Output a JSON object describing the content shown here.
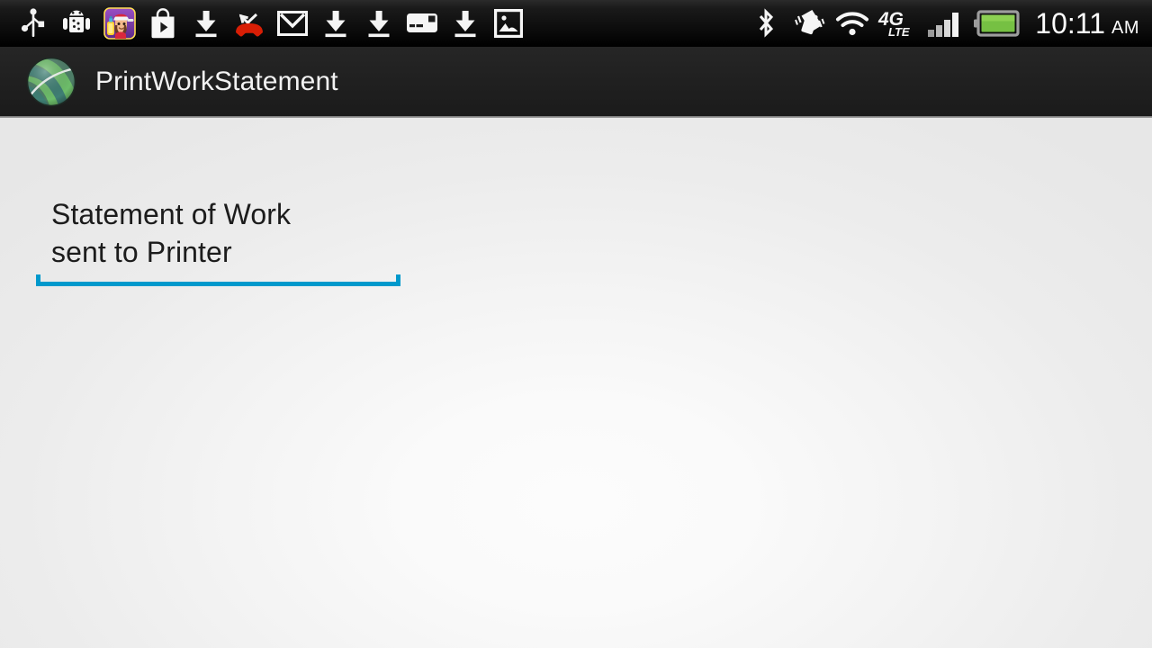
{
  "status_bar": {
    "left_icons": [
      {
        "name": "usb-icon",
        "label": "USB connected"
      },
      {
        "name": "android-debug-icon",
        "label": "USB debugging connected"
      },
      {
        "name": "subway-surfers-app-icon",
        "label": "Subway Surfers"
      },
      {
        "name": "play-store-icon",
        "label": "Google Play Store"
      },
      {
        "name": "download-icon-1",
        "label": "Download complete"
      },
      {
        "name": "missed-call-icon",
        "label": "Missed call"
      },
      {
        "name": "gmail-icon",
        "label": "Gmail"
      },
      {
        "name": "download-icon-2",
        "label": "Download complete"
      },
      {
        "name": "download-icon-3",
        "label": "Download complete"
      },
      {
        "name": "sms-message-icon",
        "label": "New message"
      },
      {
        "name": "download-icon-4",
        "label": "Download complete"
      },
      {
        "name": "screenshot-image-icon",
        "label": "Screenshot captured"
      }
    ],
    "right_icons": [
      {
        "name": "bluetooth-icon",
        "label": "Bluetooth on"
      },
      {
        "name": "vibrate-icon",
        "label": "Vibrate mode"
      },
      {
        "name": "wifi-icon",
        "label": "Wi-Fi connected"
      },
      {
        "name": "network-type-icon",
        "label": "4G LTE"
      },
      {
        "name": "cell-signal-icon",
        "label": "Signal strength"
      },
      {
        "name": "battery-icon",
        "label": "Battery"
      }
    ],
    "network_primary": "4G",
    "network_secondary": "LTE",
    "time": "10:11",
    "meridiem": "AM"
  },
  "action_bar": {
    "app_title": "PrintWorkStatement",
    "logo_name": "att-globe-logo"
  },
  "main": {
    "text_field": {
      "value": "Statement of Work\nsent to Printer",
      "placeholder": "",
      "underline_color": "#0099cc"
    }
  },
  "colors": {
    "accent": "#0099cc",
    "status_bar_bg": "#0d0d0d",
    "action_bar_bg": "#202020",
    "content_bg": "#f2f2f2",
    "battery_green": "#76c043",
    "missed_call_red": "#d81e05"
  }
}
